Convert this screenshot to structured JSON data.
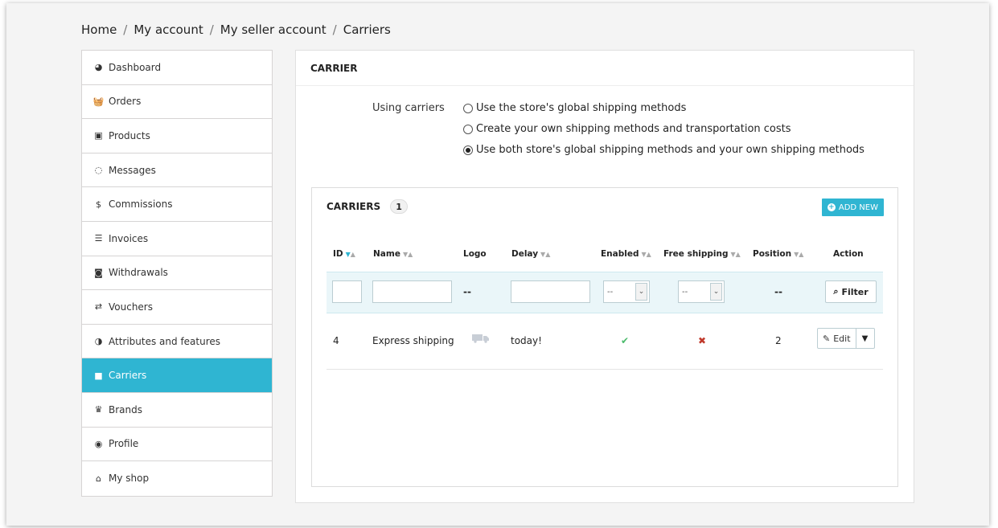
{
  "breadcrumb": [
    "Home",
    "My account",
    "My seller account",
    "Carriers"
  ],
  "breadcrumb_sep": "/",
  "sidebar": {
    "items": [
      {
        "label": "Dashboard",
        "icon": "dashboard-icon",
        "glyph": "◕"
      },
      {
        "label": "Orders",
        "icon": "basket-icon",
        "glyph": "🧺"
      },
      {
        "label": "Products",
        "icon": "gift-icon",
        "glyph": "▣"
      },
      {
        "label": "Messages",
        "icon": "comment-icon",
        "glyph": "◌"
      },
      {
        "label": "Commissions",
        "icon": "dollar-icon",
        "glyph": "$"
      },
      {
        "label": "Invoices",
        "icon": "list-icon",
        "glyph": "☰"
      },
      {
        "label": "Withdrawals",
        "icon": "money-icon",
        "glyph": "◙"
      },
      {
        "label": "Vouchers",
        "icon": "exchange-icon",
        "glyph": "⇄"
      },
      {
        "label": "Attributes and features",
        "icon": "contrast-icon",
        "glyph": "◑"
      },
      {
        "label": "Carriers",
        "icon": "truck-icon",
        "glyph": "■"
      },
      {
        "label": "Brands",
        "icon": "trophy-icon",
        "glyph": "♛"
      },
      {
        "label": "Profile",
        "icon": "user-circle-icon",
        "glyph": "◉"
      },
      {
        "label": "My shop",
        "icon": "home-icon",
        "glyph": "⌂"
      }
    ],
    "active_index": 9,
    "active_color": "#2fb5d2"
  },
  "panel": {
    "title": "CARRIER",
    "using_carriers_label": "Using carriers",
    "options": [
      {
        "label": "Use the store's global shipping methods",
        "selected": false
      },
      {
        "label": "Create your own shipping methods and transportation costs",
        "selected": false
      },
      {
        "label": "Use both store's global shipping methods and your own shipping methods",
        "selected": true
      }
    ]
  },
  "list": {
    "title": "CARRIERS",
    "count": "1",
    "add_label": "ADD NEW",
    "columns": [
      "ID",
      "Name",
      "Logo",
      "Delay",
      "Enabled",
      "Free shipping",
      "Position",
      "Action"
    ],
    "filter": {
      "logo": "--",
      "enabled": "--",
      "free_shipping": "--",
      "position": "--",
      "button": "Filter"
    },
    "rows": [
      {
        "id": "4",
        "name": "Express shipping",
        "delay": "today!",
        "enabled": true,
        "free_shipping": false,
        "position": "2",
        "action": "Edit"
      }
    ]
  }
}
